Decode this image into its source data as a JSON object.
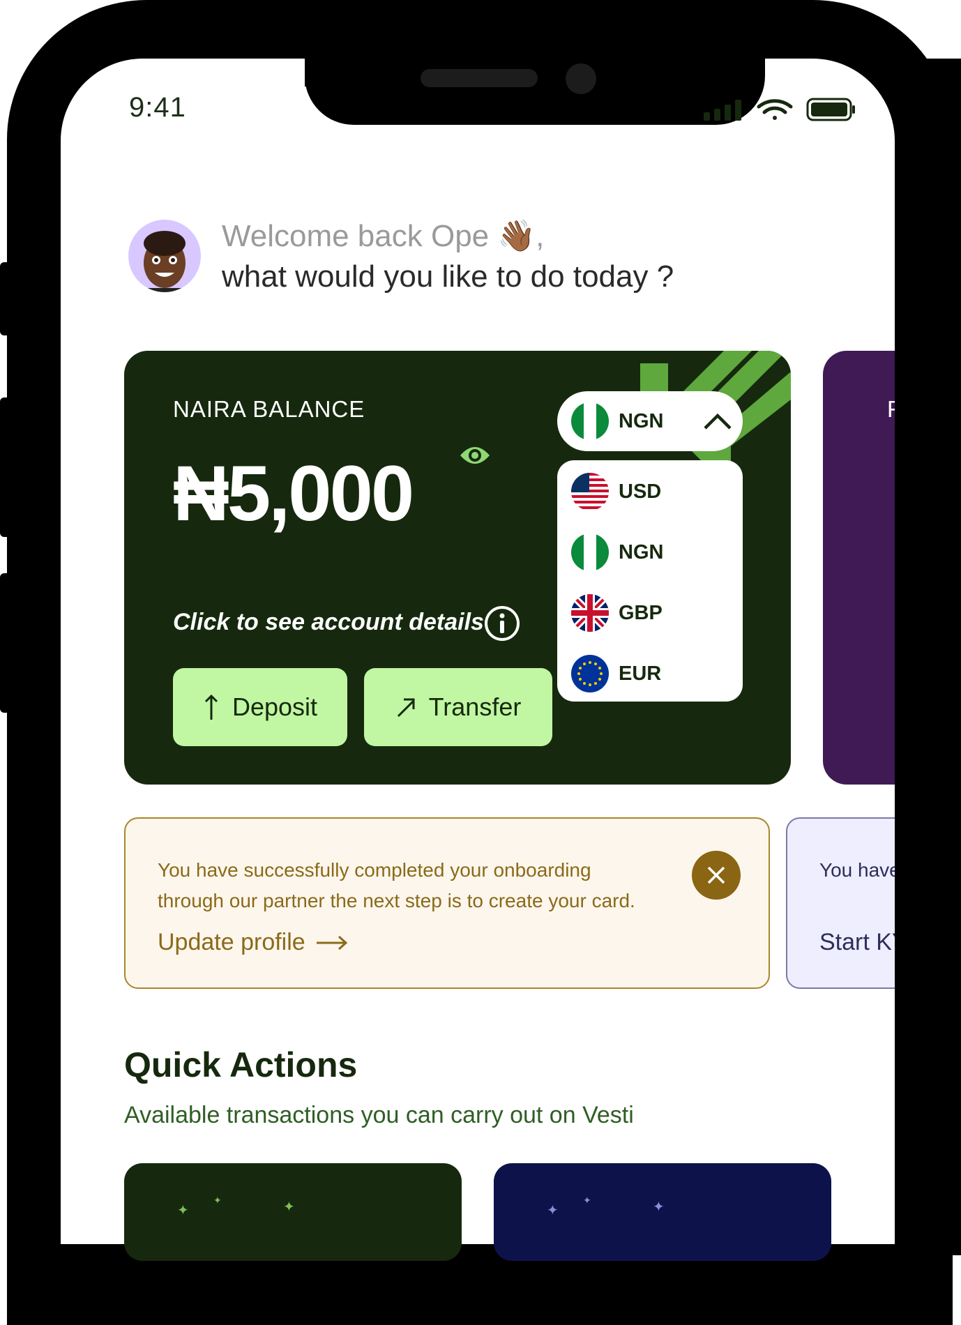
{
  "status_bar": {
    "time": "9:41"
  },
  "greeting": {
    "welcome": "Welcome back Ope 👋🏾,",
    "question": "what would you like to do today ?"
  },
  "balance_card": {
    "label": "NAIRA BALANCE",
    "amount": "₦5,000",
    "details_link": "Click to see account details",
    "deposit_label": "Deposit",
    "transfer_label": "Transfer",
    "selected_currency": "NGN",
    "currency_options": [
      {
        "code": "USD",
        "icon": "us-flag-icon"
      },
      {
        "code": "NGN",
        "icon": "ng-flag-icon"
      },
      {
        "code": "GBP",
        "icon": "gb-flag-icon"
      },
      {
        "code": "EUR",
        "icon": "eu-flag-icon"
      }
    ],
    "colors": {
      "card_bg": "#16290e",
      "button_bg": "#c1f6a3",
      "eye": "#8fd874",
      "accent_arrow": "#5ea83e"
    }
  },
  "second_card": {
    "colors": {
      "bg": "#3f1a54"
    },
    "label_partial": "F"
  },
  "notice": {
    "text": "You have successfully completed your onboarding through our partner the next step is to create your card.",
    "link": "Update profile",
    "colors": {
      "bg": "#fdf6ec",
      "border": "#a9862c",
      "text": "#8a6a1a"
    }
  },
  "notice2": {
    "text_partial": "You have through",
    "link_partial": "Start KY",
    "colors": {
      "bg": "#eeeefe",
      "border": "#7a79a8"
    }
  },
  "quick_actions": {
    "title": "Quick Actions",
    "subtitle": "Available transactions  you can carry out on Vesti"
  }
}
